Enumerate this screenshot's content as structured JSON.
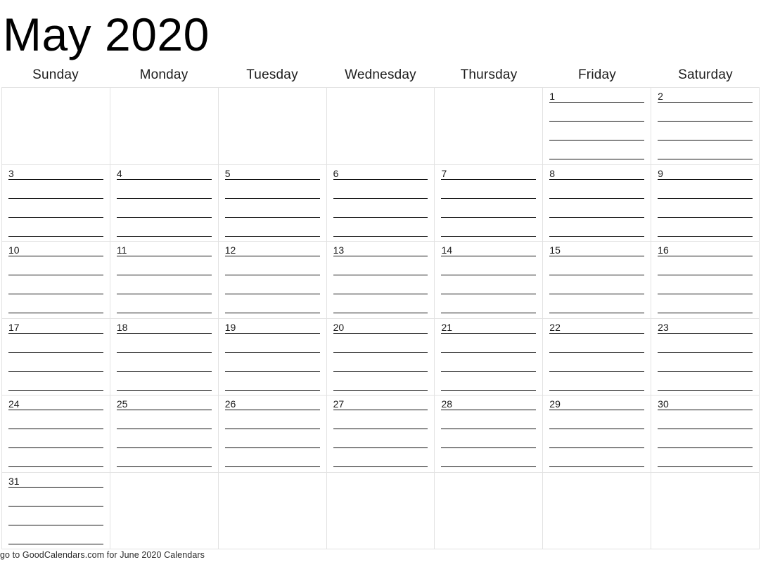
{
  "title": "May 2020",
  "month_name": "May",
  "year": "2020",
  "weekdays": [
    "Sunday",
    "Monday",
    "Tuesday",
    "Wednesday",
    "Thursday",
    "Friday",
    "Saturday"
  ],
  "lines_per_day": 4,
  "weeks": [
    {
      "days": [
        {
          "number": ""
        },
        {
          "number": ""
        },
        {
          "number": ""
        },
        {
          "number": ""
        },
        {
          "number": ""
        },
        {
          "number": "1"
        },
        {
          "number": "2"
        }
      ]
    },
    {
      "days": [
        {
          "number": "3"
        },
        {
          "number": "4"
        },
        {
          "number": "5"
        },
        {
          "number": "6"
        },
        {
          "number": "7"
        },
        {
          "number": "8"
        },
        {
          "number": "9"
        }
      ]
    },
    {
      "days": [
        {
          "number": "10"
        },
        {
          "number": "11"
        },
        {
          "number": "12"
        },
        {
          "number": "13"
        },
        {
          "number": "14"
        },
        {
          "number": "15"
        },
        {
          "number": "16"
        }
      ]
    },
    {
      "days": [
        {
          "number": "17"
        },
        {
          "number": "18"
        },
        {
          "number": "19"
        },
        {
          "number": "20"
        },
        {
          "number": "21"
        },
        {
          "number": "22"
        },
        {
          "number": "23"
        }
      ]
    },
    {
      "days": [
        {
          "number": "24"
        },
        {
          "number": "25"
        },
        {
          "number": "26"
        },
        {
          "number": "27"
        },
        {
          "number": "28"
        },
        {
          "number": "29"
        },
        {
          "number": "30"
        }
      ]
    },
    {
      "days": [
        {
          "number": "31"
        },
        {
          "number": ""
        },
        {
          "number": ""
        },
        {
          "number": ""
        },
        {
          "number": ""
        },
        {
          "number": ""
        },
        {
          "number": ""
        }
      ]
    }
  ],
  "footer": {
    "text": "go to GoodCalendars.com for June 2020 Calendars"
  },
  "colors": {
    "grid_line": "#e2e2e2",
    "write_line": "#111111",
    "text": "#1a1a1a",
    "background": "#ffffff"
  }
}
